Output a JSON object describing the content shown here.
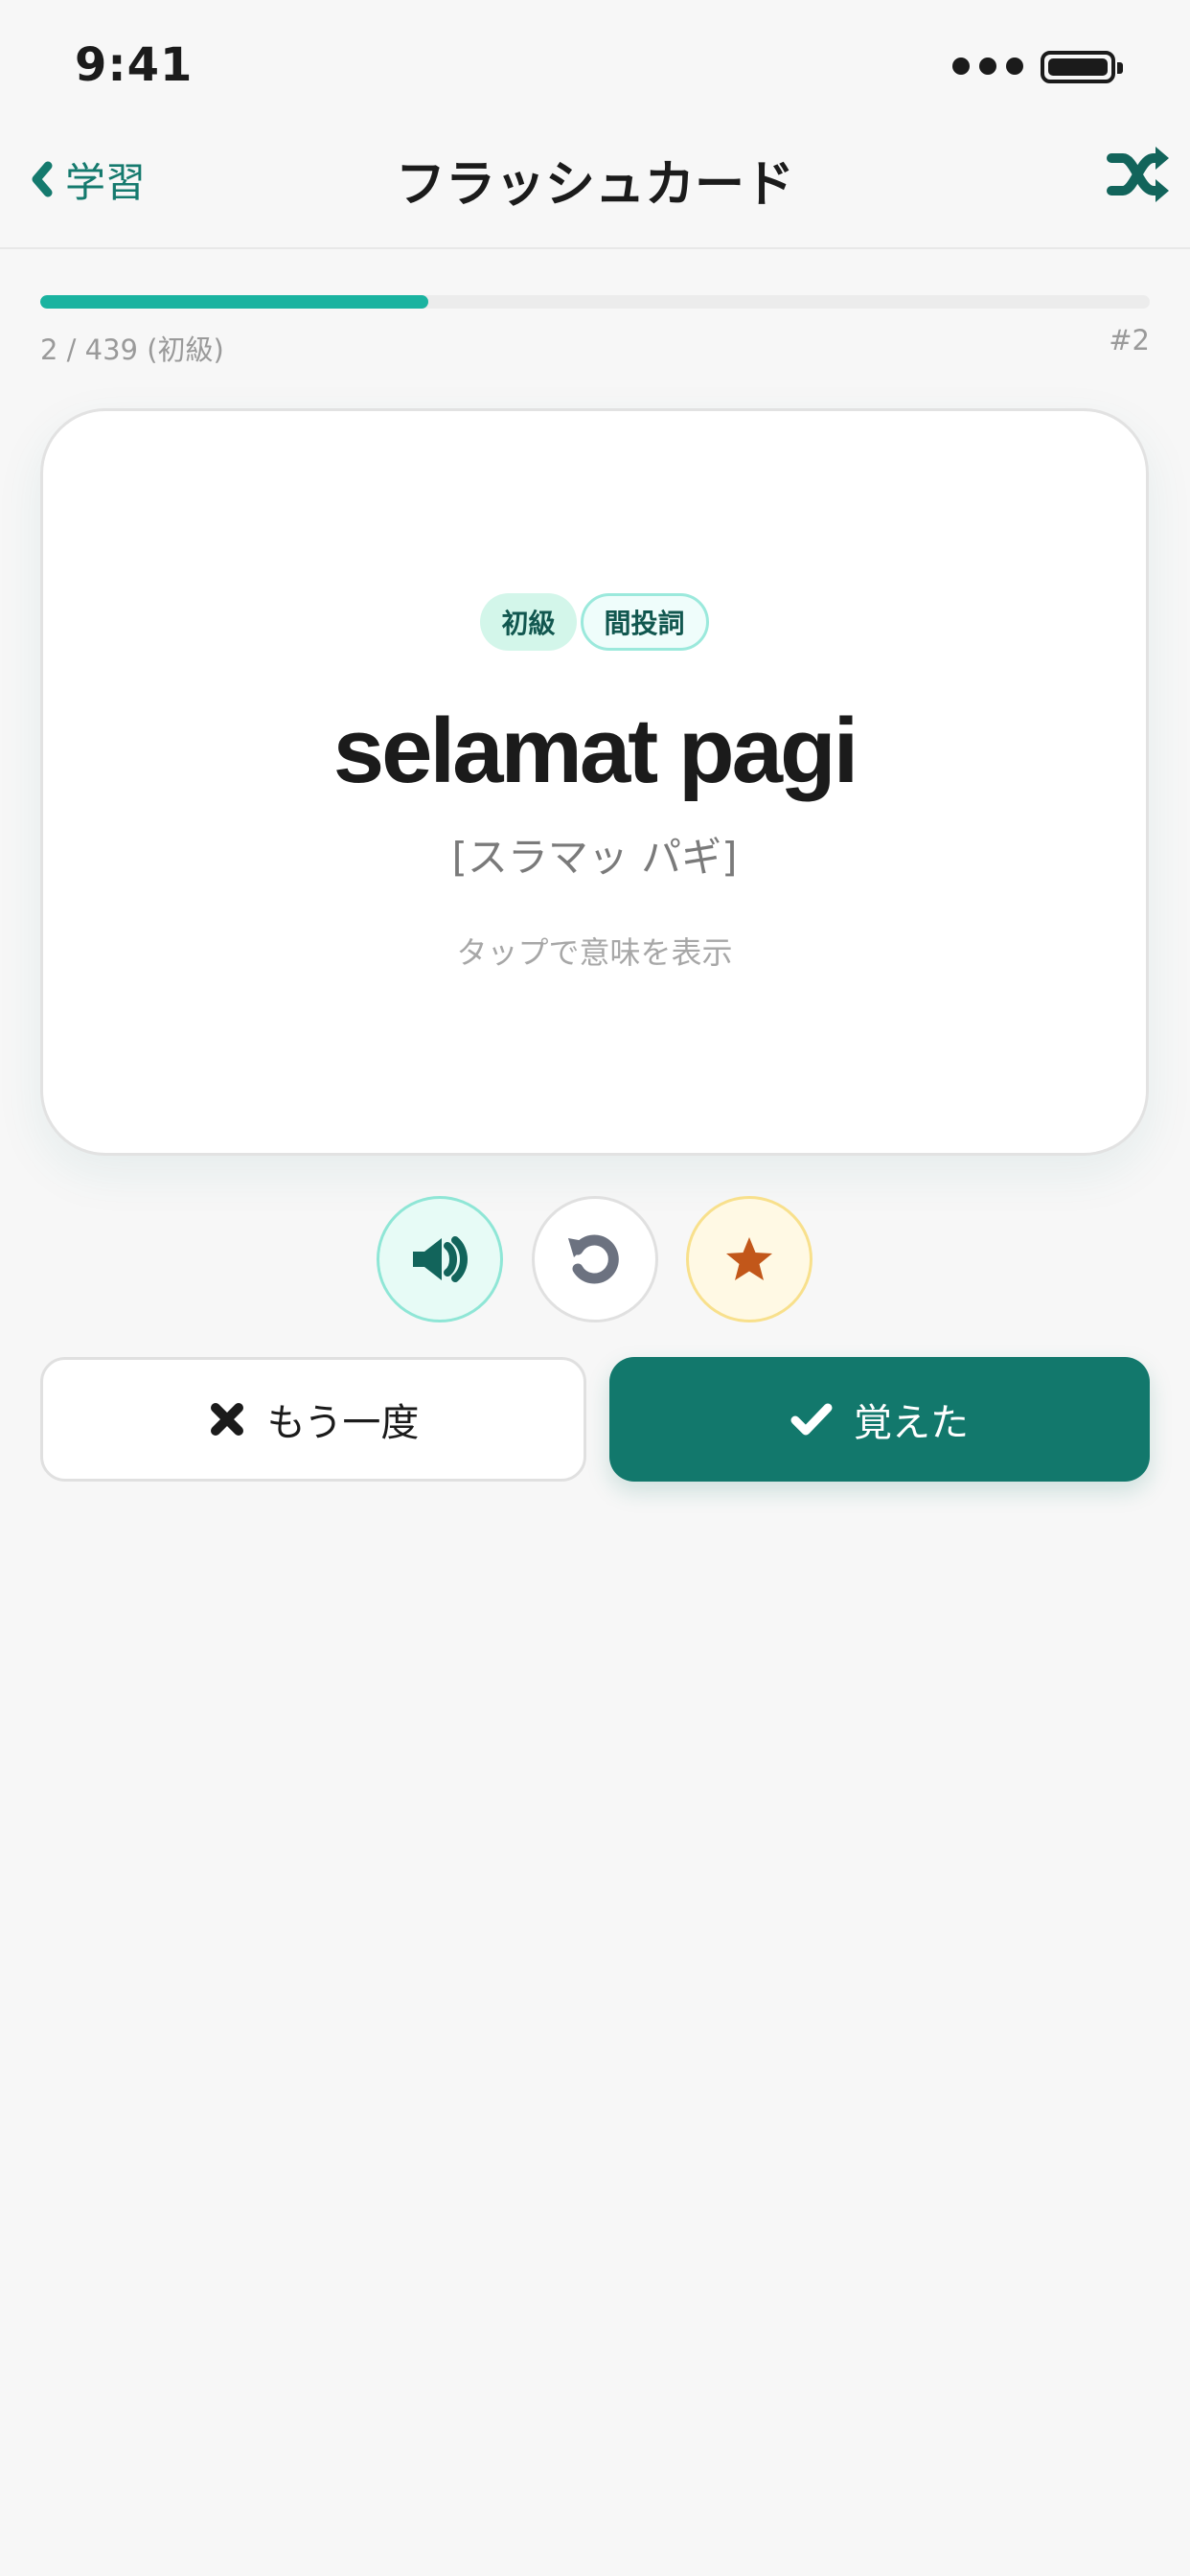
{
  "status_bar": {
    "time": "9:41"
  },
  "nav": {
    "back_label": "学習",
    "title": "フラッシュカード",
    "shuffle_icon": "shuffle-icon"
  },
  "progress": {
    "label": "2 / 439 (初級)",
    "index": "#2",
    "fraction": 0.35
  },
  "card": {
    "level_tag": "初級",
    "pos_tag": "間投詞",
    "word": "selamat pagi",
    "reading": "[スラマッ パギ]",
    "hint": "タップで意味を表示"
  },
  "controls": {
    "audio_icon": "speaker-icon",
    "flip_icon": "rotate-icon",
    "star_icon": "star-icon"
  },
  "actions": {
    "again_label": "もう一度",
    "learned_label": "覚えた"
  },
  "colors": {
    "accent": "#12786c",
    "progress": "#1ab3a0",
    "star": "#c2571a"
  }
}
